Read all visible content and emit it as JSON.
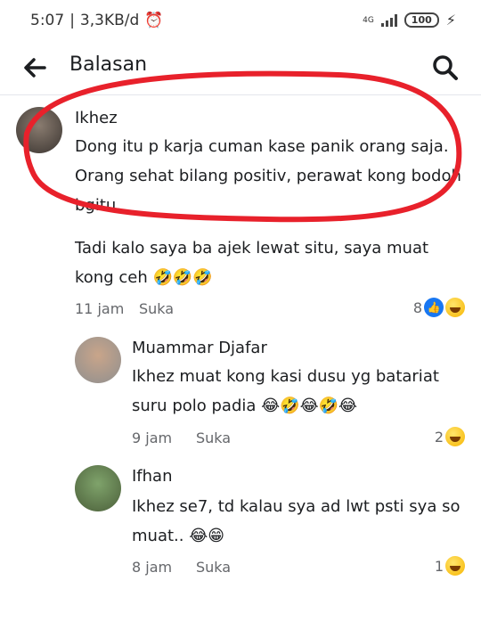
{
  "status": {
    "time": "5:07",
    "net": "3,3KB/d",
    "battery": "100",
    "gen": "4G"
  },
  "header": {
    "title": "Balasan"
  },
  "comments": [
    {
      "name": "Ikhez",
      "lines": [
        "Dong itu p karja cuman kase panik orang saja.",
        "Orang sehat bilang positiv, perawat kong bodoh",
        "bgitu."
      ]
    },
    {
      "name": "",
      "lines": [
        "Tadi kalo saya ba ajek lewat situ, saya muat",
        "kong ceh 🤣🤣🤣"
      ],
      "time": "11 jam",
      "like": "Suka",
      "count": "8"
    },
    {
      "name": "Muammar Djafar",
      "lines": [
        "Ikhez muat kong kasi dusu yg batariat",
        "suru polo padia 😂🤣😂🤣😂"
      ],
      "time": "9 jam",
      "like": "Suka",
      "count": "2"
    },
    {
      "name": "Ifhan",
      "lines": [
        "Ikhez se7, td kalau sya ad lwt psti sya so",
        "muat.. 😂😁"
      ],
      "time": "8 jam",
      "like": "Suka",
      "count": "1"
    }
  ],
  "colors": {
    "annotation": "#e8212b",
    "like": "#1877f2"
  }
}
